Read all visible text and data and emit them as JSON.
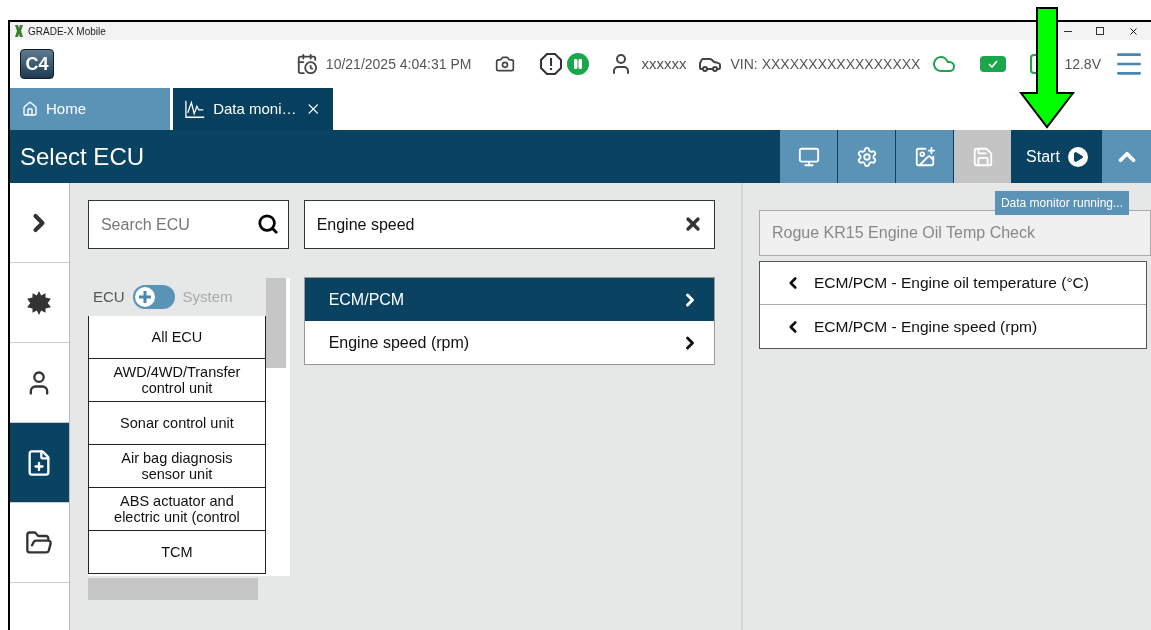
{
  "window": {
    "title": "GRADE-X Mobile"
  },
  "header": {
    "logo": "C4",
    "datetime": "10/21/2025 4:04:31 PM",
    "user": "xxxxxx",
    "vin_label": "VIN:",
    "vin": "XXXXXXXXXXXXXXXXX",
    "voltage": "12.8V"
  },
  "tabs": [
    {
      "label": "Home",
      "kind": "home",
      "selected": false
    },
    {
      "label": "Data moni…",
      "kind": "monitor",
      "selected": true
    }
  ],
  "toolbar": {
    "title": "Select ECU",
    "buttons": [
      {
        "kind": "screens",
        "disabled": false
      },
      {
        "kind": "gear",
        "disabled": false
      },
      {
        "kind": "add-record",
        "disabled": false
      },
      {
        "kind": "save",
        "disabled": true
      }
    ],
    "start": "Start",
    "tooltip": "Data monitor running..."
  },
  "rail": [
    {
      "kind": "chevron",
      "selected": false
    },
    {
      "kind": "burst",
      "selected": false
    },
    {
      "kind": "user",
      "selected": false
    },
    {
      "kind": "doc-add",
      "selected": true
    },
    {
      "kind": "folder",
      "selected": false
    }
  ],
  "ecu_panel": {
    "search_placeholder": "Search ECU",
    "toggle": {
      "left": "ECU",
      "right": "System",
      "on": false
    },
    "items": [
      "All ECU",
      "AWD/4WD/Transfer control unit",
      "Sonar control unit",
      "Air bag diagnosis sensor unit",
      "ABS actuator and electric unit (control",
      "TCM"
    ]
  },
  "parameters": {
    "filter": "Engine speed",
    "items": [
      {
        "label": "ECM/PCM",
        "selected": true
      },
      {
        "label": "Engine speed (rpm)",
        "selected": false
      }
    ]
  },
  "selection": {
    "name_placeholder": "Rogue KR15 Engine Oil Temp Check",
    "items": [
      "ECM/PCM - Engine oil temperature (°C)",
      "ECM/PCM - Engine speed (rpm)"
    ]
  }
}
